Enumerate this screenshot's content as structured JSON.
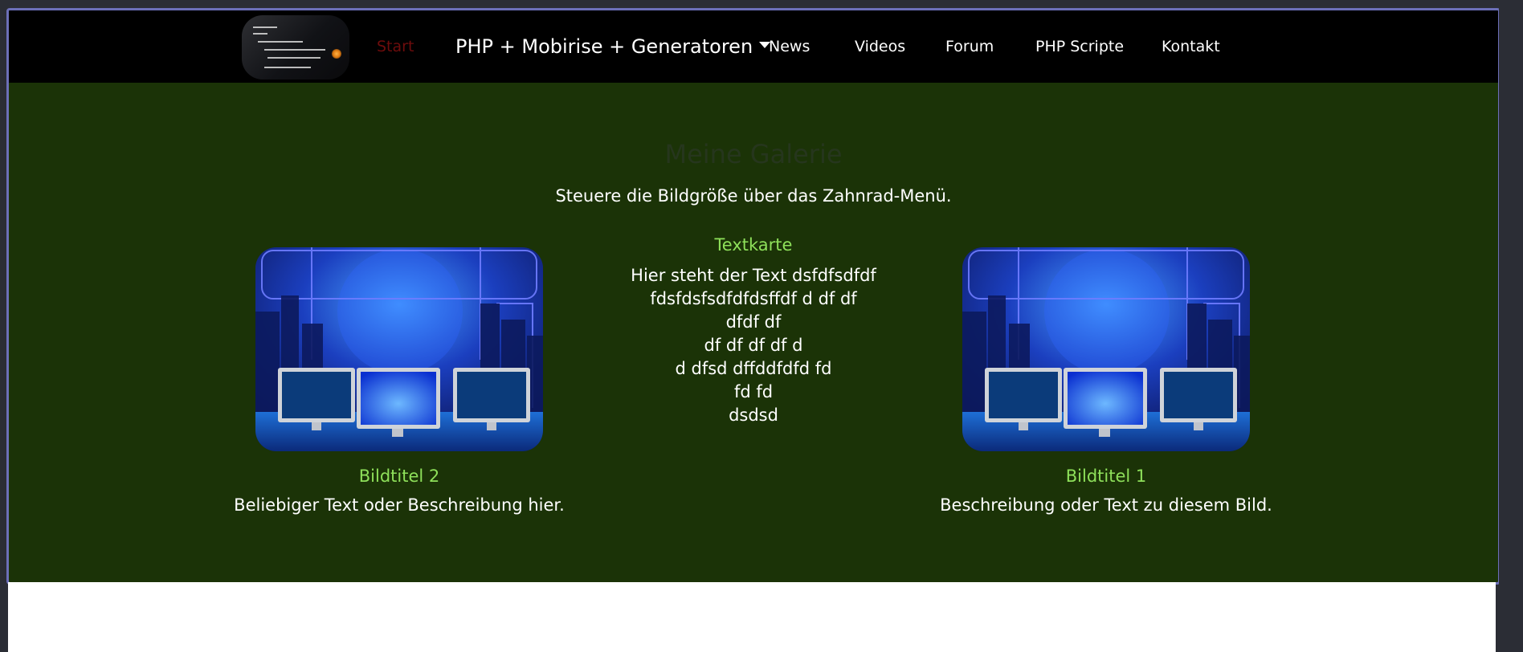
{
  "navbar": {
    "logo_alt": "Logo",
    "items": [
      {
        "label": "Start",
        "active": true
      },
      {
        "label": "PHP + Mobirise + Generatoren",
        "dropdown": true
      },
      {
        "label": "News"
      },
      {
        "label": "Videos"
      },
      {
        "label": "Forum"
      },
      {
        "label": "PHP Scripte"
      },
      {
        "label": "Kontakt"
      }
    ]
  },
  "gallery": {
    "title": "Meine Galerie",
    "subtitle": "Steuere die Bildgröße über das Zahnrad-Menü."
  },
  "cards": {
    "left": {
      "title": "Bildtitel 2",
      "description": "Beliebiger Text oder Beschreibung hier."
    },
    "center": {
      "title": "Textkarte",
      "body": "Hier steht der Text dsfdfsdfdf\nfdsfdsfsdfdfdsffdf d df  df\ndfdf df\ndf df df df d\nd dfsd dffddfdfd fd\nfd fd\ndsdsd"
    },
    "right": {
      "title": "Bildtitel 1",
      "description": "Beschreibung oder Text zu diesem Bild."
    }
  },
  "colors": {
    "navbar_bg": "#000000",
    "content_bg": "#1b3307",
    "accent_title": "#8ee05a",
    "frame_border": "#6c6fb8",
    "active_nav": "#6e0c0c"
  }
}
